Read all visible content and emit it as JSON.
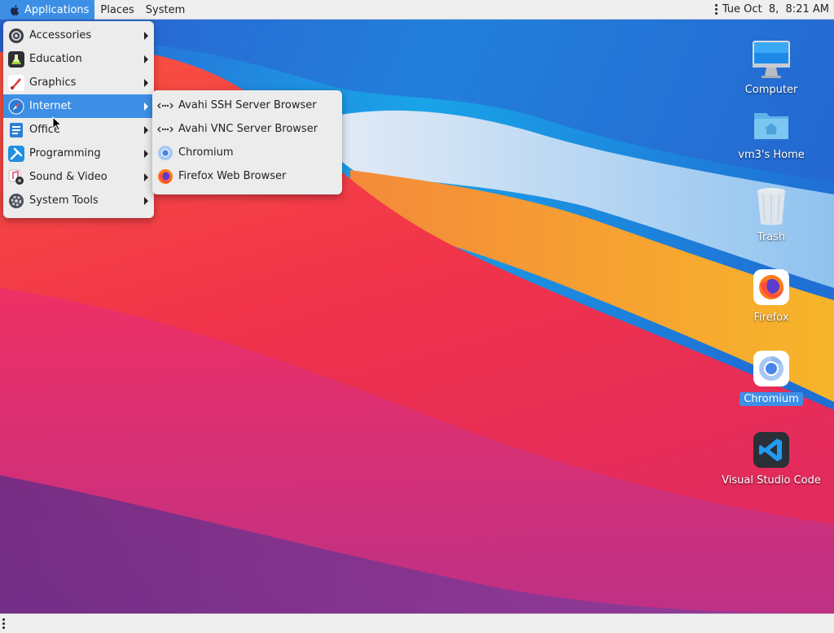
{
  "panel": {
    "applications_label": "Applications",
    "places_label": "Places",
    "system_label": "System",
    "clock": "Tue Oct  8,  8:21 AM"
  },
  "main_menu": {
    "items": [
      {
        "label": "Accessories",
        "icon": "accessories-icon"
      },
      {
        "label": "Education",
        "icon": "education-icon"
      },
      {
        "label": "Graphics",
        "icon": "graphics-icon"
      },
      {
        "label": "Internet",
        "icon": "internet-icon",
        "highlighted": true
      },
      {
        "label": "Office",
        "icon": "office-icon"
      },
      {
        "label": "Programming",
        "icon": "programming-icon"
      },
      {
        "label": "Sound & Video",
        "icon": "sound-video-icon"
      },
      {
        "label": "System Tools",
        "icon": "system-tools-icon"
      }
    ]
  },
  "internet_submenu": {
    "items": [
      {
        "label": "Avahi SSH Server Browser",
        "icon": "network-dots-icon"
      },
      {
        "label": "Avahi VNC Server Browser",
        "icon": "network-dots-icon"
      },
      {
        "label": "Chromium",
        "icon": "chromium-icon"
      },
      {
        "label": "Firefox Web Browser",
        "icon": "firefox-icon"
      }
    ]
  },
  "desktop": {
    "icons": [
      {
        "label": "Computer",
        "icon": "computer-icon"
      },
      {
        "label": "vm3's Home",
        "icon": "home-folder-icon"
      },
      {
        "label": "Trash",
        "icon": "trash-icon"
      },
      {
        "label": "Firefox",
        "icon": "firefox-icon"
      },
      {
        "label": "Chromium",
        "icon": "chromium-icon",
        "selected": true
      },
      {
        "label": "Visual Studio Code",
        "icon": "vscode-icon"
      }
    ]
  },
  "colors": {
    "accent": "#3d8fe6",
    "panel_bg": "#efefef",
    "menu_bg": "#ececec"
  }
}
